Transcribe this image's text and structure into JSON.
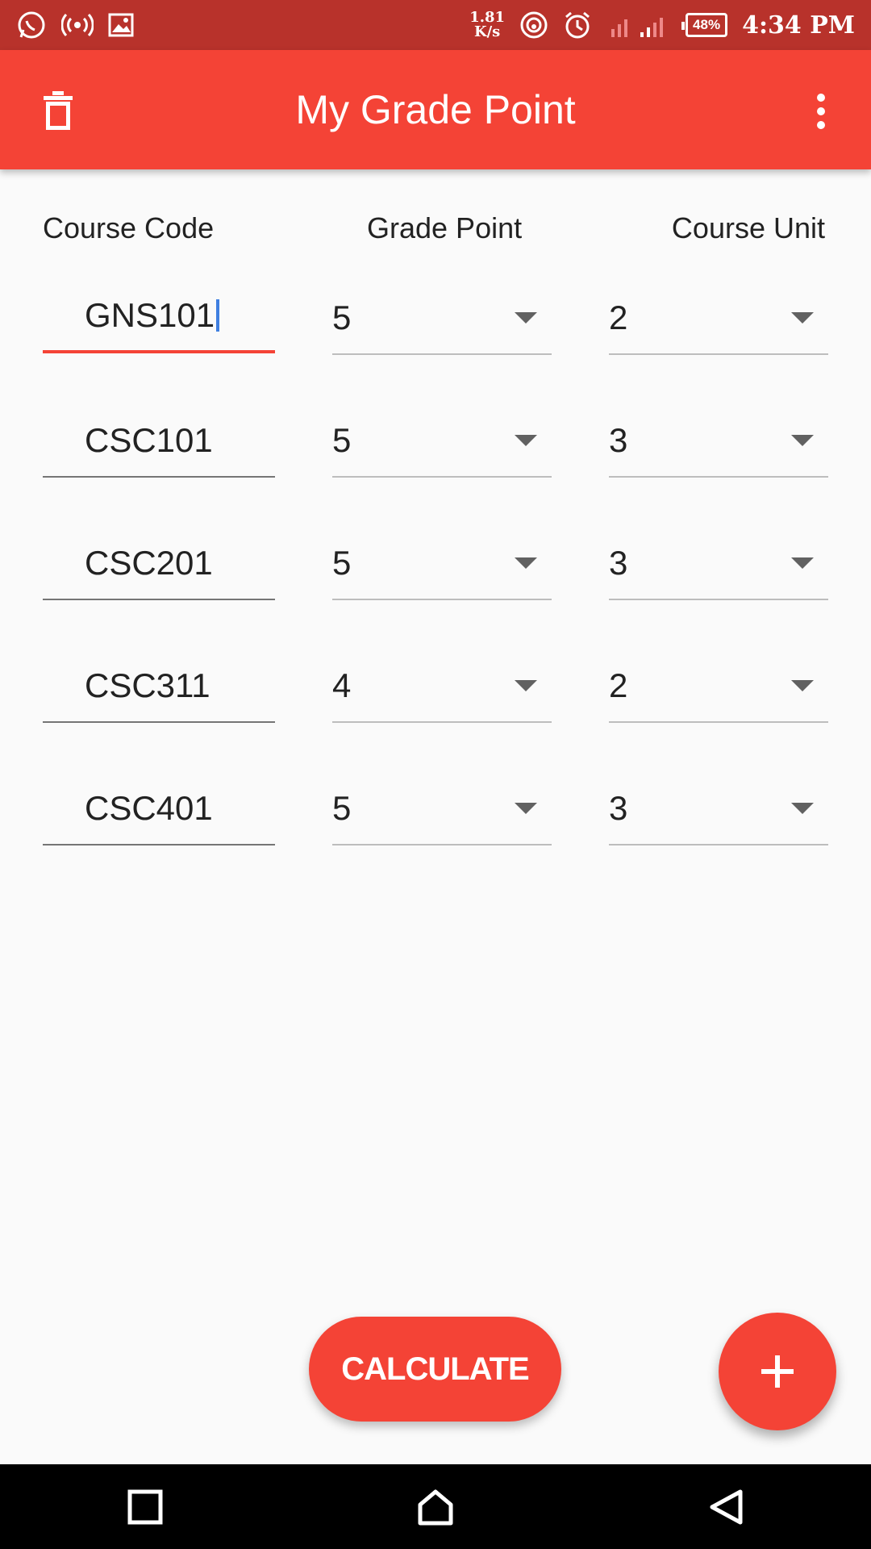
{
  "status_bar": {
    "speed_value": "1.81",
    "speed_unit": "K/s",
    "battery": "48%",
    "time": "4:34 PM",
    "icons": [
      "whatsapp-icon",
      "hotspot-icon",
      "gallery-icon",
      "wifi-icon",
      "alarm-icon",
      "signal-icon"
    ]
  },
  "app_bar": {
    "title": "My Grade Point",
    "left_icon": "trash-icon",
    "right_icon": "more-vert-icon"
  },
  "headers": {
    "course_code": "Course Code",
    "grade_point": "Grade Point",
    "course_unit": "Course Unit"
  },
  "rows": [
    {
      "course_code": "GNS101",
      "grade_point": "5",
      "course_unit": "2"
    },
    {
      "course_code": "CSC101",
      "grade_point": "5",
      "course_unit": "3"
    },
    {
      "course_code": "CSC201",
      "grade_point": "5",
      "course_unit": "3"
    },
    {
      "course_code": "CSC311",
      "grade_point": "4",
      "course_unit": "2"
    },
    {
      "course_code": "CSC401",
      "grade_point": "5",
      "course_unit": "3"
    }
  ],
  "actions": {
    "calculate_label": "CALCULATE",
    "add_icon": "plus-icon"
  },
  "colors": {
    "primary": "#f44336",
    "status_bar": "#b8322b",
    "nav_bar": "#000000",
    "background": "#fafafa"
  }
}
